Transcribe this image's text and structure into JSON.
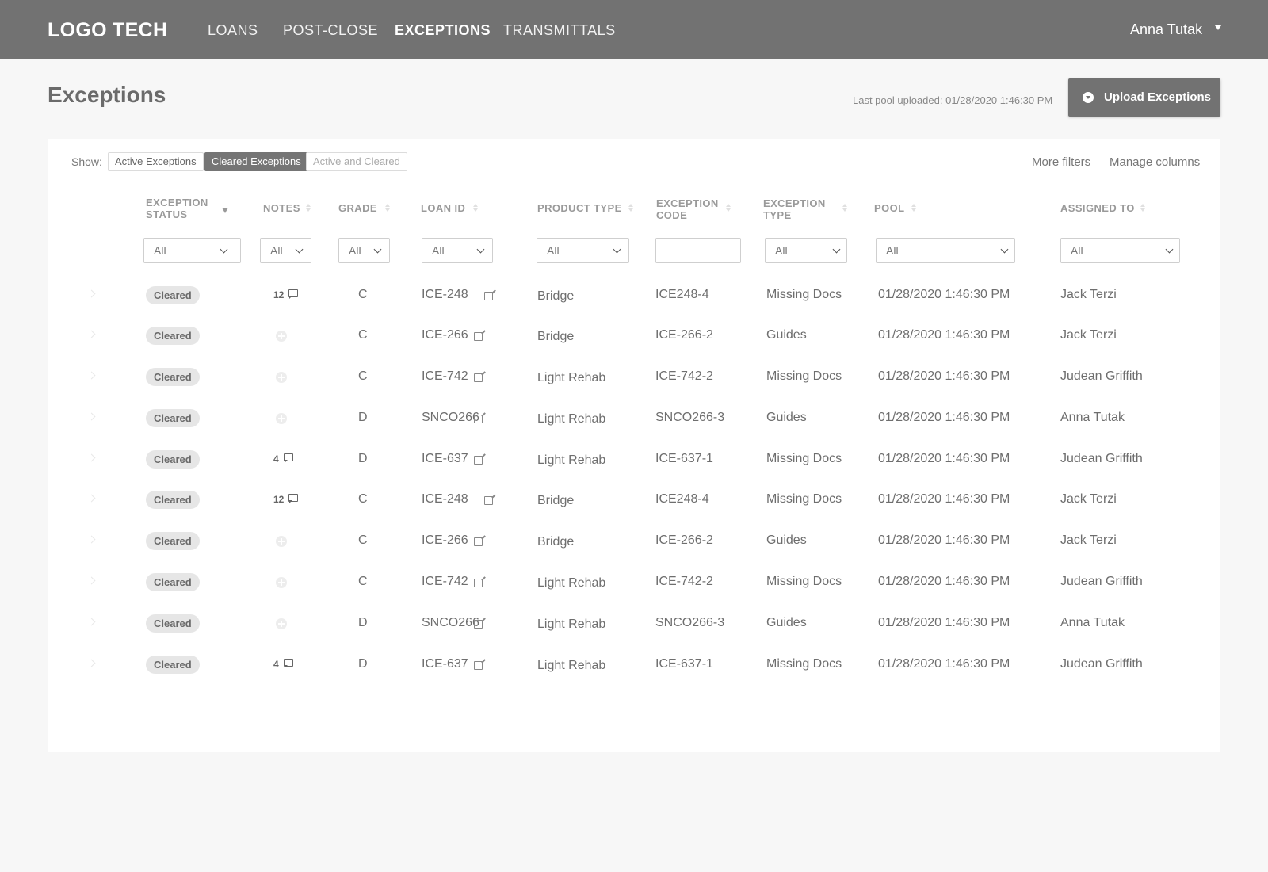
{
  "app": {
    "logo": "LOGO TECH",
    "nav": [
      "LOANS",
      "POST-CLOSE",
      "EXCEPTIONS",
      "TRANSMITTALS"
    ],
    "user": "Anna Tutak"
  },
  "page": {
    "title": "Exceptions",
    "last_pool": "Last pool uploaded: 01/28/2020 1:46:30 PM",
    "upload_label": "Upload Exceptions"
  },
  "toolbar": {
    "show_label": "Show:",
    "segments": [
      "Active Exceptions",
      "Cleared Exceptions",
      "Active and Cleared"
    ],
    "selected_segment": "Cleared Exceptions",
    "more_filters": "More filters",
    "manage_columns": "Manage columns"
  },
  "table": {
    "columns": [
      {
        "line1": "EXCEPTION",
        "line2": "STATUS"
      },
      {
        "line1": "NOTES",
        "line2": ""
      },
      {
        "line1": "GRADE",
        "line2": ""
      },
      {
        "line1": "LOAN ID",
        "line2": ""
      },
      {
        "line1": "PRODUCT TYPE",
        "line2": ""
      },
      {
        "line1": "EXCEPTION",
        "line2": "CODE"
      },
      {
        "line1": "EXCEPTION",
        "line2": "TYPE"
      },
      {
        "line1": "POOL",
        "line2": ""
      },
      {
        "line1": "ASSIGNED TO",
        "line2": ""
      }
    ],
    "filters": [
      "All",
      "All",
      "All",
      "All",
      "All",
      "",
      "All",
      "All",
      "All"
    ],
    "rows": [
      {
        "status": "Cleared",
        "notes": "12",
        "grade": "C",
        "loan_id": "ICE-248",
        "product": "Bridge",
        "code": "ICE248-4",
        "type": "Missing Docs",
        "pool": "01/28/2020 1:46:30 PM",
        "assigned": "Jack Terzi"
      },
      {
        "status": "Cleared",
        "notes": "",
        "grade": "C",
        "loan_id": "ICE-266",
        "product": "Bridge",
        "code": "ICE-266-2",
        "type": "Guides",
        "pool": "01/28/2020 1:46:30 PM",
        "assigned": "Jack Terzi"
      },
      {
        "status": "Cleared",
        "notes": "",
        "grade": "C",
        "loan_id": "ICE-742",
        "product": "Light Rehab",
        "code": "ICE-742-2",
        "type": "Missing Docs",
        "pool": "01/28/2020 1:46:30 PM",
        "assigned": "Judean Griffith"
      },
      {
        "status": "Cleared",
        "notes": "",
        "grade": "D",
        "loan_id": "SNCO266",
        "product": "Light Rehab",
        "code": "SNCO266-3",
        "type": "Guides",
        "pool": "01/28/2020 1:46:30 PM",
        "assigned": "Anna Tutak"
      },
      {
        "status": "Cleared",
        "notes": "4",
        "grade": "D",
        "loan_id": "ICE-637",
        "product": "Light Rehab",
        "code": "ICE-637-1",
        "type": "Missing Docs",
        "pool": "01/28/2020 1:46:30 PM",
        "assigned": "Judean Griffith"
      },
      {
        "status": "Cleared",
        "notes": "12",
        "grade": "C",
        "loan_id": "ICE-248",
        "product": "Bridge",
        "code": "ICE248-4",
        "type": "Missing Docs",
        "pool": "01/28/2020 1:46:30 PM",
        "assigned": "Jack Terzi"
      },
      {
        "status": "Cleared",
        "notes": "",
        "grade": "C",
        "loan_id": "ICE-266",
        "product": "Bridge",
        "code": "ICE-266-2",
        "type": "Guides",
        "pool": "01/28/2020 1:46:30 PM",
        "assigned": "Jack Terzi"
      },
      {
        "status": "Cleared",
        "notes": "",
        "grade": "C",
        "loan_id": "ICE-742",
        "product": "Light Rehab",
        "code": "ICE-742-2",
        "type": "Missing Docs",
        "pool": "01/28/2020 1:46:30 PM",
        "assigned": "Judean Griffith"
      },
      {
        "status": "Cleared",
        "notes": "",
        "grade": "D",
        "loan_id": "SNCO266",
        "product": "Light Rehab",
        "code": "SNCO266-3",
        "type": "Guides",
        "pool": "01/28/2020 1:46:30 PM",
        "assigned": "Anna Tutak"
      },
      {
        "status": "Cleared",
        "notes": "4",
        "grade": "D",
        "loan_id": "ICE-637",
        "product": "Light Rehab",
        "code": "ICE-637-1",
        "type": "Missing Docs",
        "pool": "01/28/2020 1:46:30 PM",
        "assigned": "Judean Griffith"
      }
    ]
  },
  "colors": {
    "topbar": "#727272",
    "badge_bg": "#e6e6e6",
    "page_bg": "#f7f7f7"
  }
}
